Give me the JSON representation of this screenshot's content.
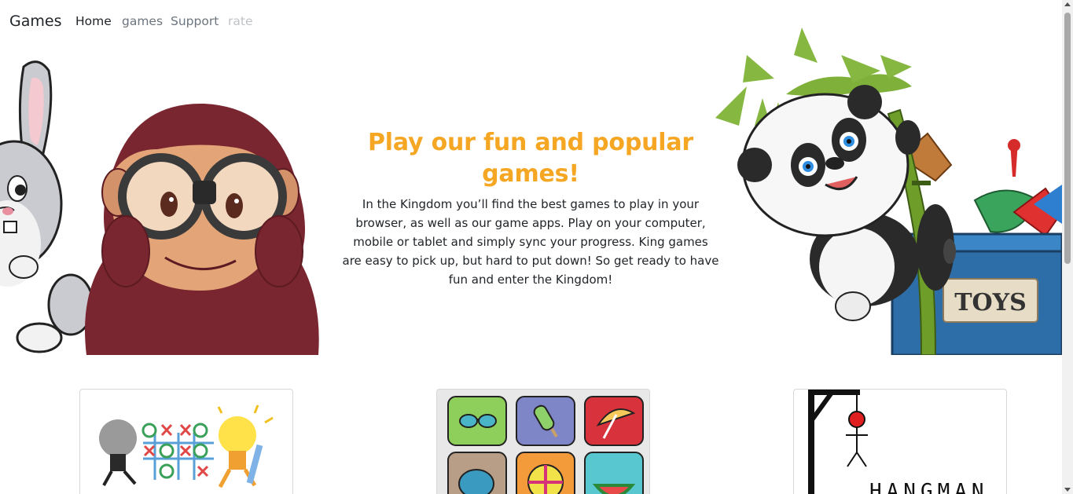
{
  "navbar": {
    "brand": "Games",
    "links": {
      "home": "Home",
      "games": "games",
      "support": "Support",
      "rate": "rate"
    }
  },
  "hero": {
    "title": "Play our fun and popular games!",
    "body": "In the Kingdom you’ll find the best games to play in your browser, as well as our game apps. Play on your computer, mobile or tablet and simply sync your progress. King games are easy to pick up, but hard to put down! So get ready to have fun and enter the Kingdom!",
    "left_image": "bunny-and-monkey-with-binoculars",
    "right_image": "panda-on-bamboo-with-toy-box",
    "toy_box_label": "TOYS"
  },
  "cards": [
    {
      "image": "tic-tac-toe-lightbulbs"
    },
    {
      "image": "memory-match-tiles"
    },
    {
      "image": "hangman",
      "label": "HANGMAN"
    }
  ],
  "colors": {
    "title": "#f5a623",
    "nav_active": "#212529",
    "nav_muted": "#6c757d",
    "nav_disabled": "#c0c3c6"
  }
}
